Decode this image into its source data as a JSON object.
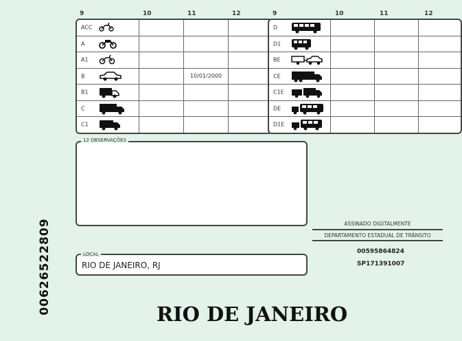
{
  "column_headers": [
    "9",
    "10",
    "11",
    "12"
  ],
  "left_table": [
    {
      "code": "ACC",
      "icon": "moped-icon",
      "d10": "",
      "d11": "",
      "d12": ""
    },
    {
      "code": "A",
      "icon": "motorcycle-icon",
      "d10": "",
      "d11": "",
      "d12": ""
    },
    {
      "code": "A1",
      "icon": "small-motorcycle-icon",
      "d10": "",
      "d11": "",
      "d12": ""
    },
    {
      "code": "B",
      "icon": "car-icon",
      "d10": "",
      "d11": "10/01/2000",
      "d12": ""
    },
    {
      "code": "B1",
      "icon": "quadricycle-icon",
      "d10": "",
      "d11": "",
      "d12": ""
    },
    {
      "code": "C",
      "icon": "truck-icon",
      "d10": "",
      "d11": "",
      "d12": ""
    },
    {
      "code": "C1",
      "icon": "light-truck-icon",
      "d10": "",
      "d11": "",
      "d12": ""
    }
  ],
  "right_table": [
    {
      "code": "D",
      "icon": "bus-icon",
      "d10": "",
      "d11": "",
      "d12": ""
    },
    {
      "code": "D1",
      "icon": "minibus-icon",
      "d10": "",
      "d11": "",
      "d12": ""
    },
    {
      "code": "BE",
      "icon": "car-trailer-icon",
      "d10": "",
      "d11": "",
      "d12": ""
    },
    {
      "code": "CE",
      "icon": "truck-trailer-icon",
      "d10": "",
      "d11": "",
      "d12": ""
    },
    {
      "code": "C1E",
      "icon": "light-truck-trailer-icon",
      "d10": "",
      "d11": "",
      "d12": ""
    },
    {
      "code": "DE",
      "icon": "bus-trailer-icon",
      "d10": "",
      "d11": "",
      "d12": ""
    },
    {
      "code": "D1E",
      "icon": "minibus-trailer-icon",
      "d10": "",
      "d11": "",
      "d12": ""
    }
  ],
  "observacoes_label": "12 OBSERVAÇÕES",
  "local_label": "LOCAL",
  "local_value": "RIO DE JANEIRO, RJ",
  "signature_text": "ASSINADO DIGITALMENTE",
  "department_text": "DEPARTAMENTO ESTADUAL DE TRÂNSITO",
  "number_1": "00595864824",
  "number_2": "SP171391007",
  "vertical_number": "00626522809",
  "city_name": "RIO DE JANEIRO"
}
